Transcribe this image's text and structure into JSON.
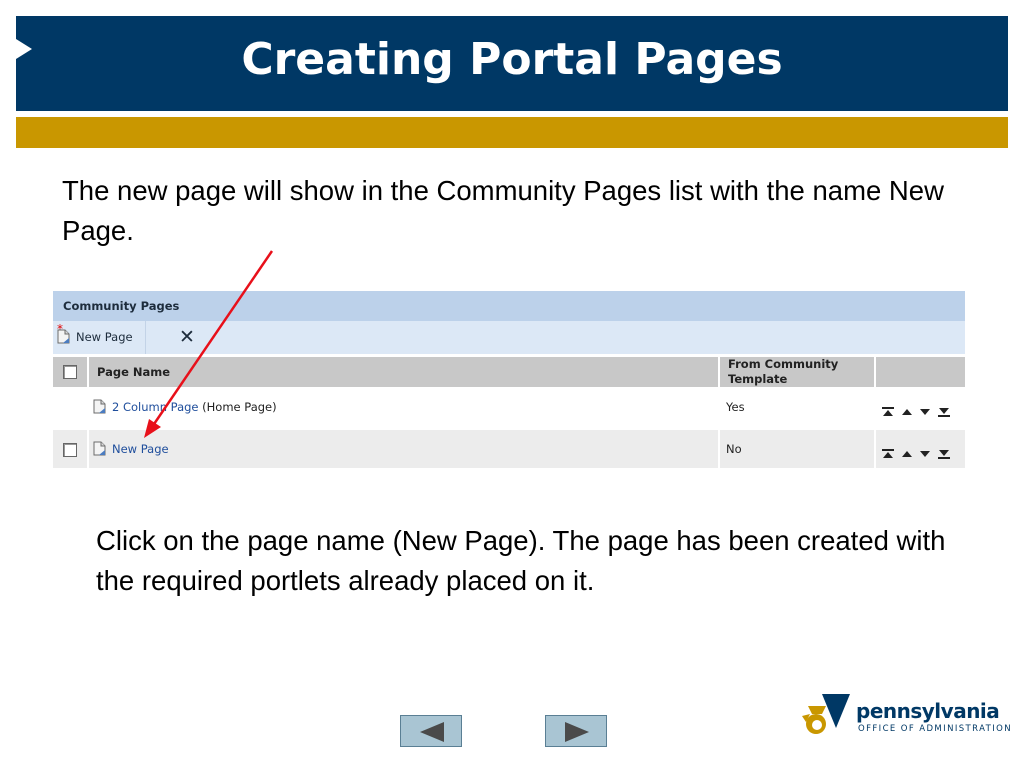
{
  "slide": {
    "title": "Creating Portal Pages",
    "intro": "The new page will show in the Community Pages list with the name New Page.",
    "instruction": "Click on the page name (New Page).  The page has been created with the required portlets already placed on it."
  },
  "panel": {
    "header": "Community Pages",
    "toolbar": {
      "new_page_label": "New Page",
      "new_marker": "*",
      "delete_glyph": "✕"
    },
    "columns": {
      "page_name": "Page Name",
      "from_template": "From Community Template"
    },
    "rows": [
      {
        "page_name": "2 Column Page",
        "suffix": "(Home Page)",
        "from_template": "Yes",
        "has_checkbox": false
      },
      {
        "page_name": "New Page",
        "suffix": "",
        "from_template": "No",
        "has_checkbox": true
      }
    ],
    "order_icons": [
      "move-top-icon",
      "move-up-icon",
      "move-down-icon",
      "move-bottom-icon"
    ]
  },
  "navigation": {
    "previous_icon": "triangle-left-icon",
    "next_icon": "triangle-right-icon"
  },
  "logo": {
    "name": "pennsylvania",
    "subtitle": "OFFICE OF ADMINISTRATION"
  },
  "colors": {
    "title_bar": "#003865",
    "accent_bar": "#C99700",
    "annotation_arrow": "#e8101a",
    "link": "#1f4e9c"
  }
}
